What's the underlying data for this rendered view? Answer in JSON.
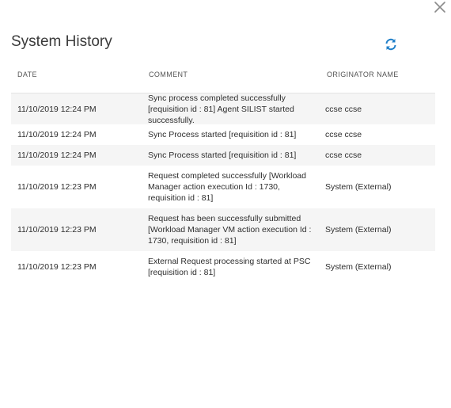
{
  "dialog": {
    "title": "System History",
    "close_icon": "close-icon",
    "refresh_icon": "refresh-icon",
    "accent_color": "#1e7ec8"
  },
  "table": {
    "headers": {
      "date": "DATE",
      "comment": "COMMENT",
      "originator": "ORIGINATOR NAME"
    },
    "rows": [
      {
        "date": "11/10/2019 12:24 PM",
        "comment": "Sync process completed successfully [requisition id : 81] Agent SILIST started successfully.",
        "originator": "ccse ccse"
      },
      {
        "date": "11/10/2019 12:24 PM",
        "comment": "Sync Process started [requisition id : 81]",
        "originator": "ccse ccse"
      },
      {
        "date": "11/10/2019 12:24 PM",
        "comment": "Sync Process started [requisition id : 81]",
        "originator": "ccse ccse"
      },
      {
        "date": "11/10/2019 12:23 PM",
        "comment": "Request completed successfully [Workload Manager action execution Id : 1730, requisition id : 81]",
        "originator": "System (External)"
      },
      {
        "date": "11/10/2019 12:23 PM",
        "comment": "Request has been successfully submitted [Workload Manager VM action execution Id : 1730, requisition id : 81]",
        "originator": "System (External)"
      },
      {
        "date": "11/10/2019 12:23 PM",
        "comment": "External Request processing started at PSC [requisition id : 81]",
        "originator": "System (External)"
      }
    ]
  }
}
